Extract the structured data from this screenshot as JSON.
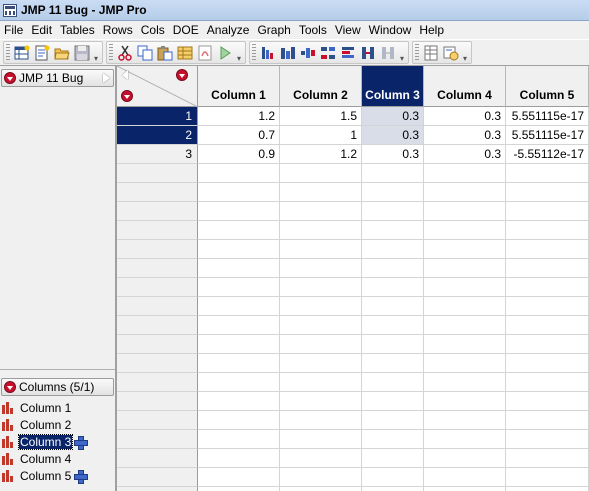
{
  "window": {
    "title": "JMP 11 Bug - JMP Pro"
  },
  "menu": [
    "File",
    "Edit",
    "Tables",
    "Rows",
    "Cols",
    "DOE",
    "Analyze",
    "Graph",
    "Tools",
    "View",
    "Window",
    "Help"
  ],
  "toolbar": {
    "group1": [
      "new-data-table-icon",
      "new-script-icon",
      "open-icon",
      "save-icon"
    ],
    "group2": [
      "cut-icon",
      "copy-icon",
      "paste-icon",
      "data-table-icon",
      "pdf-icon",
      "run-script-icon"
    ],
    "group3": [
      "distribution-icon",
      "fit-y-by-x-icon",
      "fit-model-icon",
      "multivariate-icon",
      "graph-builder-icon",
      "control-chart-icon",
      "contour-icon"
    ],
    "group4": [
      "table-summary-icon",
      "journal-icon"
    ]
  },
  "table_panel": {
    "label": "JMP 11 Bug"
  },
  "columns_panel": {
    "label": "Columns (5/1)",
    "items": [
      {
        "name": "Column 1",
        "selected": false,
        "has_formula_cross": false
      },
      {
        "name": "Column 2",
        "selected": false,
        "has_formula_cross": false
      },
      {
        "name": "Column 3",
        "selected": true,
        "has_formula_cross": true
      },
      {
        "name": "Column 4",
        "selected": false,
        "has_formula_cross": false
      },
      {
        "name": "Column 5",
        "selected": false,
        "has_formula_cross": true
      }
    ]
  },
  "grid": {
    "columns": [
      "Column 1",
      "Column 2",
      "Column 3",
      "Column 4",
      "Column 5"
    ],
    "selected_column": "Column 3",
    "selected_rows": [
      1,
      2
    ],
    "rows": [
      {
        "num": "1",
        "values": [
          "1.2",
          "1.5",
          "0.3",
          "0.3",
          "5.551115e-17"
        ]
      },
      {
        "num": "2",
        "values": [
          "0.7",
          "1",
          "0.3",
          "0.3",
          "5.551115e-17"
        ]
      },
      {
        "num": "3",
        "values": [
          "0.9",
          "1.2",
          "0.3",
          "0.3",
          "-5.55112e-17"
        ]
      }
    ]
  },
  "colors": {
    "selection": "#0a246a",
    "selected_column_cells": "#d8dde8",
    "hot_spot_red": "#c8102e",
    "column_icon_red": "#c0392b"
  }
}
